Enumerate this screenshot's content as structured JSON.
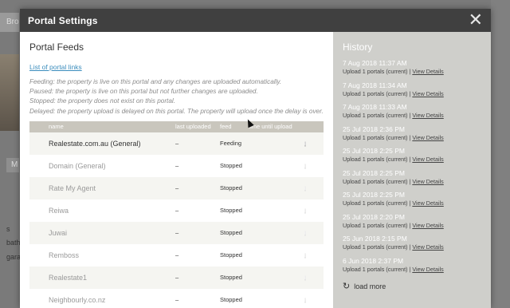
{
  "background": {
    "button_label": "Bro",
    "tab_label": "M",
    "text_lines": [
      "s",
      "bath",
      "gara"
    ]
  },
  "modal": {
    "title": "Portal Settings",
    "close_glyph": "✕"
  },
  "portal_feeds": {
    "title": "Portal Feeds",
    "link_label": "List of portal links",
    "descriptions": [
      "Feeding: the property is live on this portal and any changes are uploaded automatically.",
      "Paused: the property is live on this portal but not further changes are uploaded.",
      "Stopped: the property does not exist on this portal.",
      "Delayed: the property upload is delayed on this portal. The property will upload once the delay is over."
    ],
    "columns": [
      "name",
      "last uploaded",
      "feed",
      "time until upload"
    ],
    "rows": [
      {
        "name": "Realestate.com.au (General)",
        "last": "–",
        "feed": "Feeding",
        "time": "",
        "status": "feeding"
      },
      {
        "name": "Domain (General)",
        "last": "–",
        "feed": "Stopped",
        "time": "",
        "status": "stopped"
      },
      {
        "name": "Rate My Agent",
        "last": "–",
        "feed": "Stopped",
        "time": "",
        "status": "stopped"
      },
      {
        "name": "Reiwa",
        "last": "–",
        "feed": "Stopped",
        "time": "",
        "status": "stopped"
      },
      {
        "name": "Juwai",
        "last": "–",
        "feed": "Stopped",
        "time": "",
        "status": "stopped"
      },
      {
        "name": "Remboss",
        "last": "–",
        "feed": "Stopped",
        "time": "",
        "status": "stopped"
      },
      {
        "name": "Realestate1",
        "last": "–",
        "feed": "Stopped",
        "time": "",
        "status": "stopped"
      },
      {
        "name": "Neighbourly.co.nz",
        "last": "–",
        "feed": "Stopped",
        "time": "",
        "status": "stopped"
      }
    ],
    "info_glyph": "i"
  },
  "history": {
    "title": "History",
    "items": [
      {
        "date": "7 Aug 2018 11:37 AM",
        "text": "Upload 1 portals (current) |",
        "link": "View Details"
      },
      {
        "date": "7 Aug 2018 11:34 AM",
        "text": "Upload 1 portals (current) |",
        "link": "View Details"
      },
      {
        "date": "7 Aug 2018 11:33 AM",
        "text": "Upload 1 portals (current) |",
        "link": "View Details"
      },
      {
        "date": "25 Jul 2018 2:36 PM",
        "text": "Upload 1 portals (current) |",
        "link": "View Details"
      },
      {
        "date": "25 Jul 2018 2:25 PM",
        "text": "Upload 1 portals (current) |",
        "link": "View Details"
      },
      {
        "date": "25 Jul 2018 2:25 PM",
        "text": "Upload 1 portals (current) |",
        "link": "View Details"
      },
      {
        "date": "25 Jul 2018 2:25 PM",
        "text": "Upload 1 portals (current) |",
        "link": "View Details"
      },
      {
        "date": "25 Jul 2018 2:20 PM",
        "text": "Upload 1 portals (current) |",
        "link": "View Details"
      },
      {
        "date": "25 Jun 2018 2:15 PM",
        "text": "Upload 1 portals (current) |",
        "link": "View Details"
      },
      {
        "date": "6 Jun 2018 2:37 PM",
        "text": "Upload 1 portals (current) |",
        "link": "View Details"
      }
    ],
    "load_more_label": "load more",
    "load_more_icon": "↻"
  },
  "colors": {
    "header": "#404040",
    "history_panel": "#cfcfcb",
    "link": "#3b8dbd",
    "feeding_dot": "#7dba4f"
  }
}
